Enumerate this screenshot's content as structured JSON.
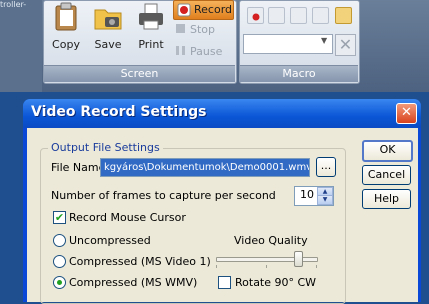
{
  "background": {
    "truncated_text": "troller-",
    "screen_group": {
      "label": "Screen",
      "buttons": [
        {
          "label": "Copy"
        },
        {
          "label": "Save"
        },
        {
          "label": "Print"
        },
        {
          "label": "Record"
        },
        {
          "label": "Stop"
        },
        {
          "label": "Pause"
        }
      ]
    },
    "macro_group": {
      "label": "Macro"
    }
  },
  "dialog": {
    "title": "Video Record Settings",
    "group_label": "Output File Settings",
    "file_name_label": "File Name",
    "file_name_value": "kgyáros\\Dokumentumok\\Demo0001.wmv",
    "browse_label": "...",
    "frames_label": "Number of frames to capture per second",
    "frames_value": "10",
    "record_cursor_label": "Record Mouse Cursor",
    "record_cursor_checked": true,
    "compression_options": [
      {
        "label": "Uncompressed",
        "selected": false
      },
      {
        "label": "Compressed (MS Video 1)",
        "selected": false
      },
      {
        "label": "Compressed (MS WMV)",
        "selected": true
      }
    ],
    "video_quality_label": "Video Quality",
    "video_quality_level": 0.82,
    "rotate_label": "Rotate 90° CW",
    "rotate_checked": false,
    "ok_label": "OK",
    "cancel_label": "Cancel",
    "help_label": "Help"
  },
  "colors": {
    "titlebar": "#0a56d6",
    "record_button": "#e07f1e",
    "check_green": "#21a121"
  }
}
